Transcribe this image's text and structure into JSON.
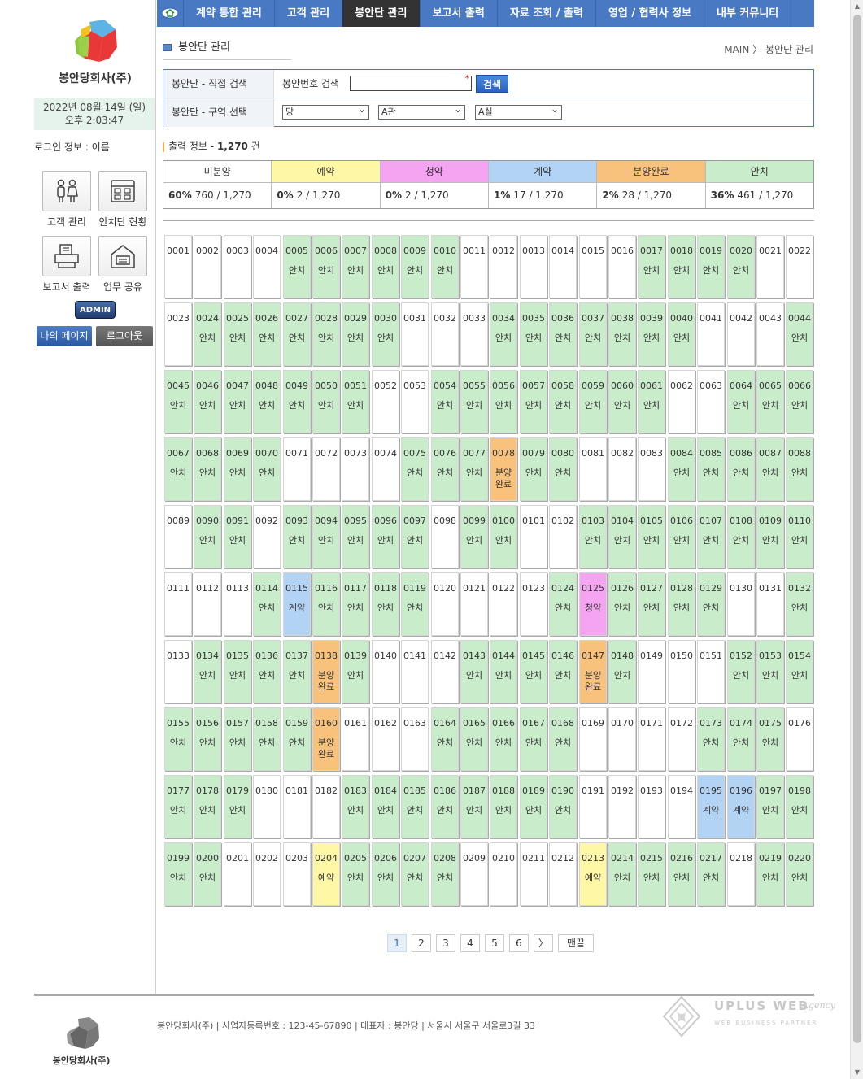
{
  "sidebar": {
    "company": "봉안당회사(주)",
    "date": "2022년  08월 14일 (일)",
    "time": "오후 2:03:47",
    "login": "로그인 정보 : 이름",
    "quick": [
      {
        "label": "고객 관리",
        "icon": "customers-icon"
      },
      {
        "label": "안치단 현황",
        "icon": "niche-status-icon"
      },
      {
        "label": "보고서 출력",
        "icon": "printer-icon"
      },
      {
        "label": "업무 공유",
        "icon": "work-share-icon"
      }
    ],
    "admin": "ADMIN",
    "mypage": "나의 페이지",
    "logout": "로그아웃"
  },
  "nav": {
    "home_icon": "home-icon",
    "items": [
      "계약 통합 관리",
      "고객 관리",
      "봉안단 관리",
      "보고서 출력",
      "자료 조회 / 출력",
      "영업 / 협력사 정보",
      "내부 커뮤니티"
    ],
    "active": 2
  },
  "page": {
    "title": "봉안단 관리",
    "crumb_main": "MAIN",
    "crumb_sep": "〉",
    "crumb_current": "봉안단 관리"
  },
  "search": {
    "direct_label": "봉안단 - 직접 검색",
    "number_label": "봉안번호 검색",
    "required_mark": "*",
    "button": "검색",
    "area_label": "봉안단 - 구역 선택",
    "select1": "당",
    "select2": "A관",
    "select3": "A실"
  },
  "output": {
    "label": "출력 정보 - ",
    "count": "1,270",
    "unit": " 건"
  },
  "stats": [
    {
      "label": "미분양",
      "pct": "60%",
      "val": "760 / 1,270",
      "color": "#ffffff"
    },
    {
      "label": "예약",
      "pct": "0%",
      "val": "2 / 1,270",
      "color": "#fdf7a6"
    },
    {
      "label": "청약",
      "pct": "0%",
      "val": "2 / 1,270",
      "color": "#f5a4f2"
    },
    {
      "label": "계약",
      "pct": "1%",
      "val": "17 / 1,270",
      "color": "#b2d3f4"
    },
    {
      "label": "분양완료",
      "pct": "2%",
      "val": "28 / 1,270",
      "color": "#f8c27c"
    },
    {
      "label": "안치",
      "pct": "36%",
      "val": "461 / 1,270",
      "color": "#c9eccb"
    }
  ],
  "grid": {
    "status_labels": {
      "s": "안치",
      "r": "예약",
      "p": "청약",
      "c": "계약",
      "d": "분양\n완료",
      "e": ""
    },
    "rows": [
      "eeeesssssseeeeeessssee",
      "essssssseeessssssseees",
      "ssssssseesssssssseesss",
      "sssseeeesssdsseeesssss",
      "essesssssesseessssssss",
      "eeescsssseeeespssssees",
      "essssdseeessssdseeesss",
      "sssssdeeessssseeeesss",
      "ssseeesssssssseeeeccss",
      "sseeersssseeeerssssess"
    ],
    "start": 1,
    "per_row": 22
  },
  "pager": {
    "pages": [
      "1",
      "2",
      "3",
      "4",
      "5",
      "6"
    ],
    "active": 0,
    "next": "〉",
    "last": "맨끝"
  },
  "footer": {
    "company": "봉안당회사(주)",
    "info": "봉안당회사(주)  |  사업자등록번호 : 123-45-67890  |  대표자 : 봉안당  |  서울시 서울구 서울로3길 33",
    "brand": "UPLUS WEB",
    "brand_sub": "WEB BUSINESS PARTNER",
    "brand_script": "Agency"
  }
}
